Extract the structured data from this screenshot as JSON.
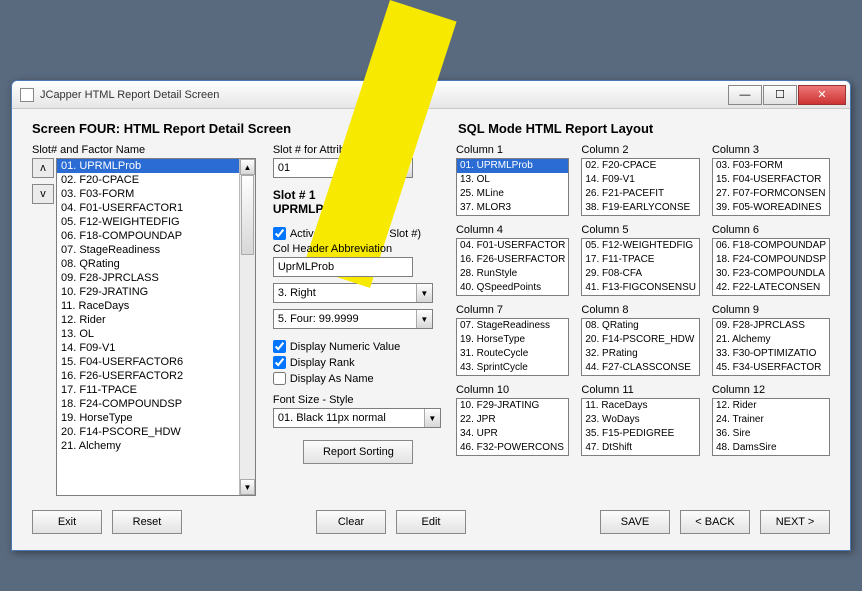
{
  "window": {
    "title": "JCapper HTML Report Detail Screen"
  },
  "heading_left": "Screen FOUR: HTML Report Detail Screen",
  "heading_right": "SQL Mode HTML Report Layout",
  "labels": {
    "slot_factor": "Slot# and Factor Name",
    "slot_attr": "Slot # for Attribute Edit",
    "active": "Active (Display This Slot #)",
    "col_abbrev": "Col Header Abbreviation",
    "disp_num": "Display Numeric Value",
    "disp_rank": "Display Rank",
    "disp_name": "Display As Name",
    "font": "Font Size - Style"
  },
  "slot_line1": "Slot # 1",
  "slot_line2": "UPRMLProb",
  "arrows": {
    "up": "ʌ",
    "down": "v"
  },
  "slot_list": [
    "01. UPRMLProb",
    "02. F20-CPACE",
    "03. F03-FORM",
    "04. F01-USERFACTOR1",
    "05. F12-WEIGHTEDFIG",
    "06. F18-COMPOUNDAP",
    "07. StageReadiness",
    "08. QRating",
    "09. F28-JPRCLASS",
    "10. F29-JRATING",
    "11. RaceDays",
    "12. Rider",
    "13. OL",
    "14. F09-V1",
    "15. F04-USERFACTOR6",
    "16. F26-USERFACTOR2",
    "17. F11-TPACE",
    "18. F24-COMPOUNDSP",
    "19. HorseType",
    "20. F14-PSCORE_HDW",
    "21. Alchemy"
  ],
  "slot_list_sel": 0,
  "attr_combo": "01",
  "abbrev_value": "UprMLProb",
  "align_combo": "3. Right",
  "format_combo": "5. Four: 99.9999",
  "font_combo": "01. Black 11px normal",
  "checks": {
    "active": true,
    "num": true,
    "rank": true,
    "name": false
  },
  "columns": [
    {
      "h": "Column 1",
      "items": [
        "01. UPRMLProb",
        "13. OL",
        "25. MLine",
        "37. MLOR3"
      ],
      "sel": 0
    },
    {
      "h": "Column 2",
      "items": [
        "02. F20-CPACE",
        "14. F09-V1",
        "26. F21-PACEFIT",
        "38. F19-EARLYCONSE"
      ]
    },
    {
      "h": "Column 3",
      "items": [
        "03. F03-FORM",
        "15. F04-USERFACTOR",
        "27. F07-FORMCONSEN",
        "39. F05-WOREADINES"
      ]
    },
    {
      "h": "Column 4",
      "items": [
        "04. F01-USERFACTOR",
        "16. F26-USERFACTOR",
        "28. RunStyle",
        "40. QSpeedPoints"
      ]
    },
    {
      "h": "Column 5",
      "items": [
        "05. F12-WEIGHTEDFIG",
        "17. F11-TPACE",
        "29. F08-CFA",
        "41. F13-FIGCONSENSU"
      ]
    },
    {
      "h": "Column 6",
      "items": [
        "06. F18-COMPOUNDAP",
        "18. F24-COMPOUNDSP",
        "30. F23-COMPOUNDLA",
        "42. F22-LATECONSEN"
      ]
    },
    {
      "h": "Column 7",
      "items": [
        "07. StageReadiness",
        "19. HorseType",
        "31. RouteCycle",
        "43. SprintCycle"
      ]
    },
    {
      "h": "Column 8",
      "items": [
        "08. QRating",
        "20. F14-PSCORE_HDW",
        "32. PRating",
        "44. F27-CLASSCONSE"
      ]
    },
    {
      "h": "Column 9",
      "items": [
        "09. F28-JPRCLASS",
        "21. Alchemy",
        "33. F30-OPTIMIZATIO",
        "45. F34-USERFACTOR"
      ]
    },
    {
      "h": "Column 10",
      "items": [
        "10. F29-JRATING",
        "22. JPR",
        "34. UPR",
        "46. F32-POWERCONS"
      ]
    },
    {
      "h": "Column 11",
      "items": [
        "11. RaceDays",
        "23. WoDays",
        "35. F15-PEDIGREE",
        "47. DtShift"
      ]
    },
    {
      "h": "Column 12",
      "items": [
        "12. Rider",
        "24. Trainer",
        "36. Sire",
        "48. DamsSire"
      ]
    }
  ],
  "buttons": {
    "exit": "Exit",
    "reset": "Reset",
    "clear": "Clear",
    "edit": "Edit",
    "save": "SAVE",
    "back": "< BACK",
    "next": "NEXT >",
    "sort": "Report Sorting"
  }
}
